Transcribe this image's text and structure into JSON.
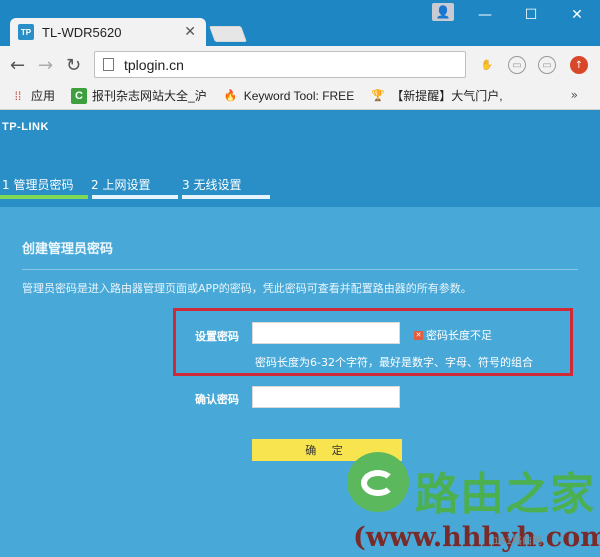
{
  "browser": {
    "tab_title": "TL-WDR5620",
    "tab_favicon_text": "TP",
    "url": "tplogin.cn",
    "bookmarks": [
      {
        "label": "应用",
        "icon": "apps-icon"
      },
      {
        "label": "报刊杂志网站大全_沪",
        "icon": "c-logo-icon"
      },
      {
        "label": "Keyword Tool: FREE",
        "icon": "keyword-tool-icon"
      },
      {
        "label": "【新提醒】大气门户,",
        "icon": "trophy-icon"
      }
    ],
    "more_label": "»"
  },
  "router": {
    "logo_text": "TP-LINK",
    "steps": [
      {
        "label": "1 管理员密码",
        "active": true
      },
      {
        "label": "2 上网设置",
        "active": false
      },
      {
        "label": "3 无线设置",
        "active": false
      }
    ],
    "panel_title": "创建管理员密码",
    "panel_description": "管理员密码是进入路由器管理页面或APP的密码，凭此密码可查看并配置路由器的所有参数。",
    "set_password_label": "设置密码",
    "set_password_value": "",
    "error_text": "密码长度不足",
    "hint_text": "密码长度为6-32个字符，最好是数字、字母、符号的组合",
    "confirm_password_label": "确认密码",
    "confirm_password_value": "",
    "confirm_button": "确 定"
  },
  "watermark": {
    "brand": "路由之家",
    "url": "(www.hhhyh.com",
    "sub": "191路由网"
  },
  "colors": {
    "page_bg": "#2a8fc6",
    "panel_bg": "#48a9d8",
    "active_step": "#7ed957",
    "confirm_btn": "#f8e44f",
    "highlight_border": "#cf2a36"
  }
}
